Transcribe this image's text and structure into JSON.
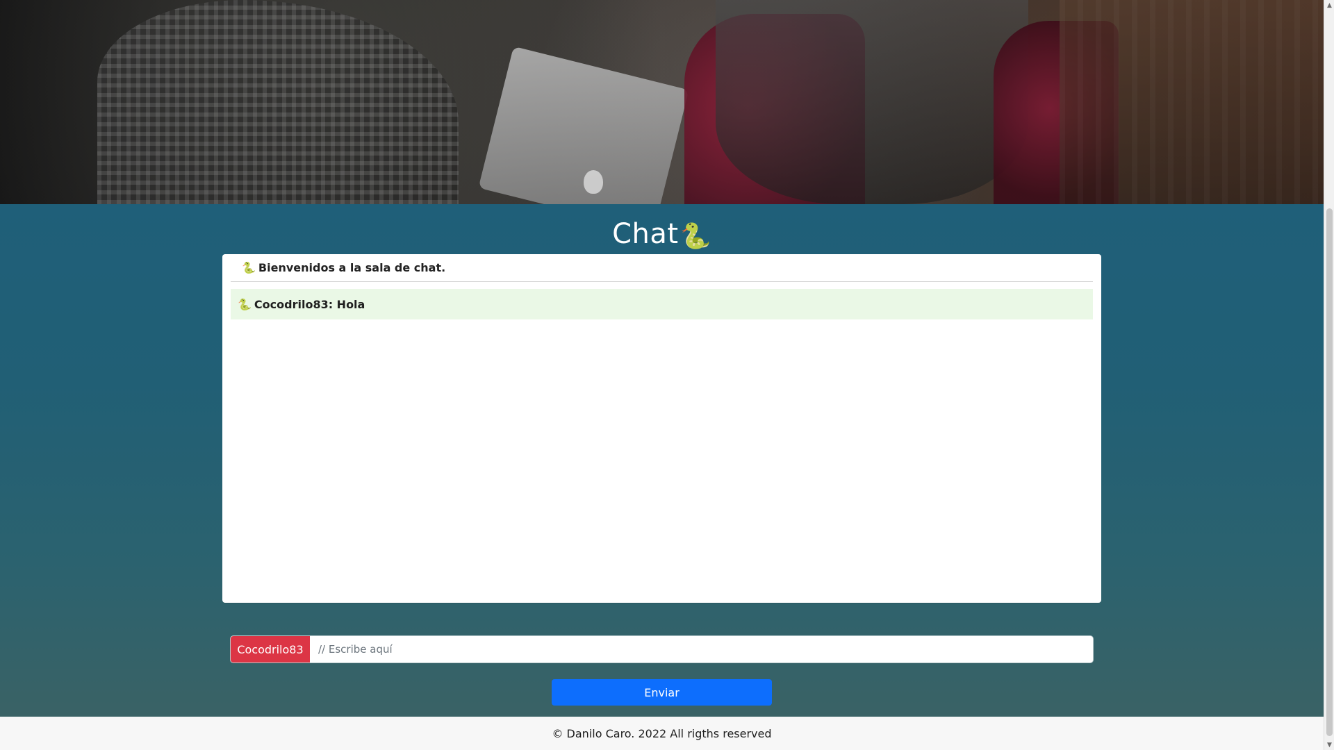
{
  "page": {
    "title": "Chat",
    "title_icon": "🐍"
  },
  "chat": {
    "welcome_icon": "🐍",
    "welcome_text": "Bienvenidos a la sala de chat.",
    "messages": [
      {
        "icon": "🐍",
        "text": "Cocodrilo83: Hola"
      }
    ]
  },
  "composer": {
    "username": "Cocodrilo83",
    "placeholder": "// Escribe aquí",
    "send_label": "Enviar"
  },
  "footer": {
    "text": "© Danilo Caro. 2022 All rigths reserved"
  },
  "colors": {
    "main_teal": "#215f75",
    "chip_red": "#dc3545",
    "button_blue": "#0d6efd",
    "message_bg": "#eaf8e6"
  },
  "scrollbar": {
    "up_arrow": "▲",
    "down_arrow": "▼"
  }
}
